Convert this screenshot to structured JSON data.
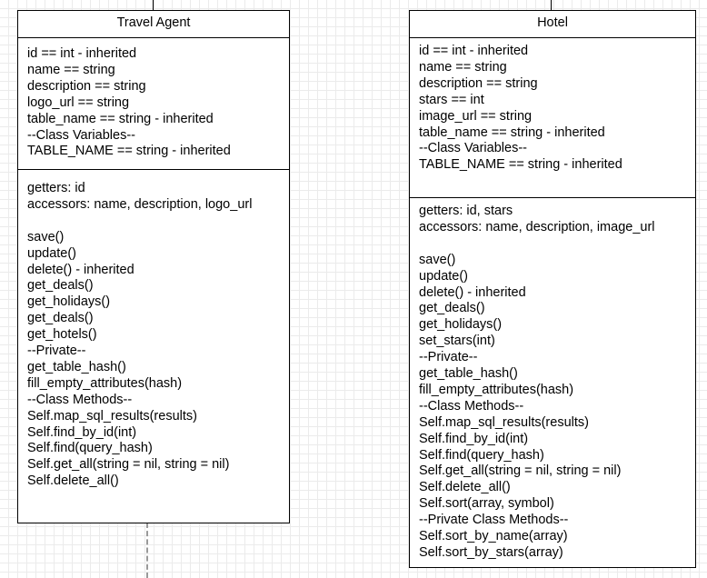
{
  "travel_agent": {
    "title": "Travel Agent",
    "attributes": [
      "id == int - inherited",
      "name == string",
      "description == string",
      "logo_url == string",
      "table_name == string - inherited",
      "--Class Variables--",
      "TABLE_NAME == string - inherited"
    ],
    "methods": [
      "getters: id",
      "accessors: name, description, logo_url",
      "",
      "save()",
      "update()",
      "delete() - inherited",
      "get_deals()",
      "get_holidays()",
      "get_deals()",
      "get_hotels()",
      "--Private--",
      "get_table_hash()",
      "fill_empty_attributes(hash)",
      "--Class Methods--",
      "Self.map_sql_results(results)",
      "Self.find_by_id(int)",
      "Self.find(query_hash)",
      "Self.get_all(string = nil, string = nil)",
      "Self.delete_all()"
    ]
  },
  "hotel": {
    "title": "Hotel",
    "attributes": [
      "id == int - inherited",
      "name == string",
      "description == string",
      "stars == int",
      "image_url == string",
      "table_name == string - inherited",
      "--Class Variables--",
      "TABLE_NAME == string - inherited"
    ],
    "methods": [
      "getters: id, stars",
      "accessors: name, description, image_url",
      "",
      "save()",
      "update()",
      "delete() - inherited",
      "get_deals()",
      "get_holidays()",
      "set_stars(int)",
      "--Private--",
      "get_table_hash()",
      "fill_empty_attributes(hash)",
      "--Class Methods--",
      "Self.map_sql_results(results)",
      "Self.find_by_id(int)",
      "Self.find(query_hash)",
      "Self.get_all(string = nil, string = nil)",
      "Self.delete_all()",
      "Self.sort(array, symbol)",
      "--Private Class Methods--",
      "Self.sort_by_name(array)",
      "Self.sort_by_stars(array)"
    ]
  }
}
